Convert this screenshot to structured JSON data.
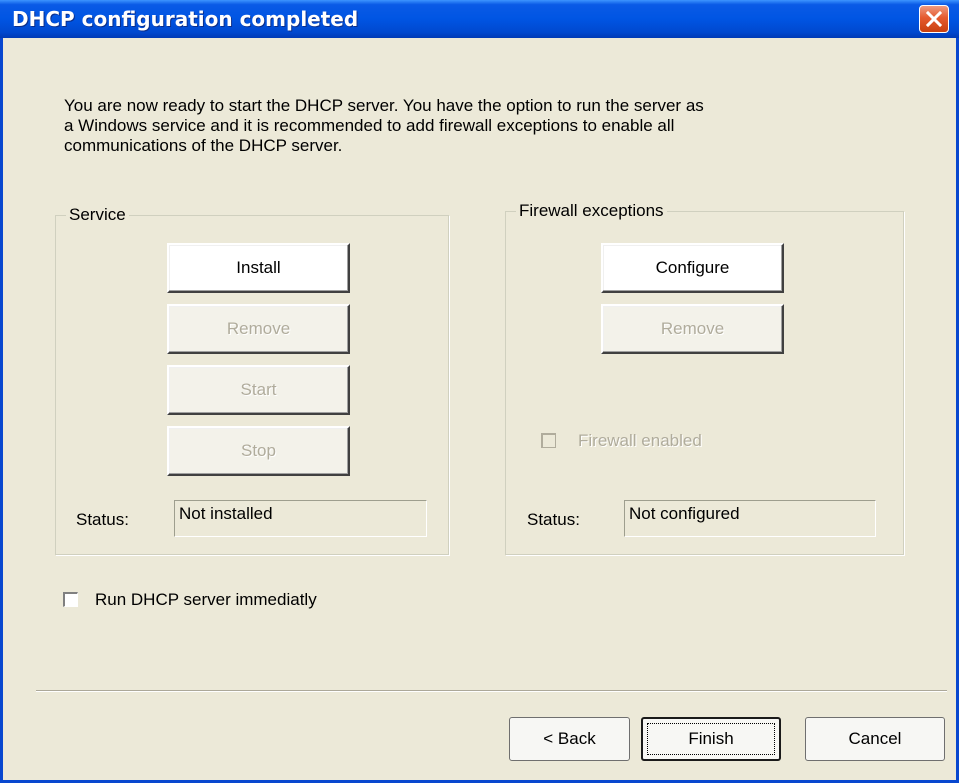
{
  "window": {
    "title": "DHCP configuration completed",
    "close_icon": "close-x-icon"
  },
  "intro": {
    "line1": "You are now ready to start the DHCP server. You have the option to run the server as",
    "line2": "a Windows service and it is recommended to add firewall exceptions to enable all",
    "line3": "communications of the DHCP server."
  },
  "service": {
    "title": "Service",
    "install_label": "Install",
    "remove_label": "Remove",
    "start_label": "Start",
    "stop_label": "Stop",
    "status_label": "Status:",
    "status_value": "Not installed"
  },
  "firewall": {
    "title": "Firewall exceptions",
    "configure_label": "Configure",
    "remove_label": "Remove",
    "enabled_label": "Firewall enabled",
    "enabled_checked": false,
    "status_label": "Status:",
    "status_value": "Not configured"
  },
  "run_immediately": {
    "label": "Run DHCP server immediatly",
    "checked": false
  },
  "footer": {
    "back_label": "< Back",
    "finish_label": "Finish",
    "cancel_label": "Cancel"
  },
  "colors": {
    "titlebar": "#0055e3",
    "dialog_bg": "#ece9d8",
    "disabled_text": "#b0ac9c",
    "close_button": "#e55a2f"
  }
}
